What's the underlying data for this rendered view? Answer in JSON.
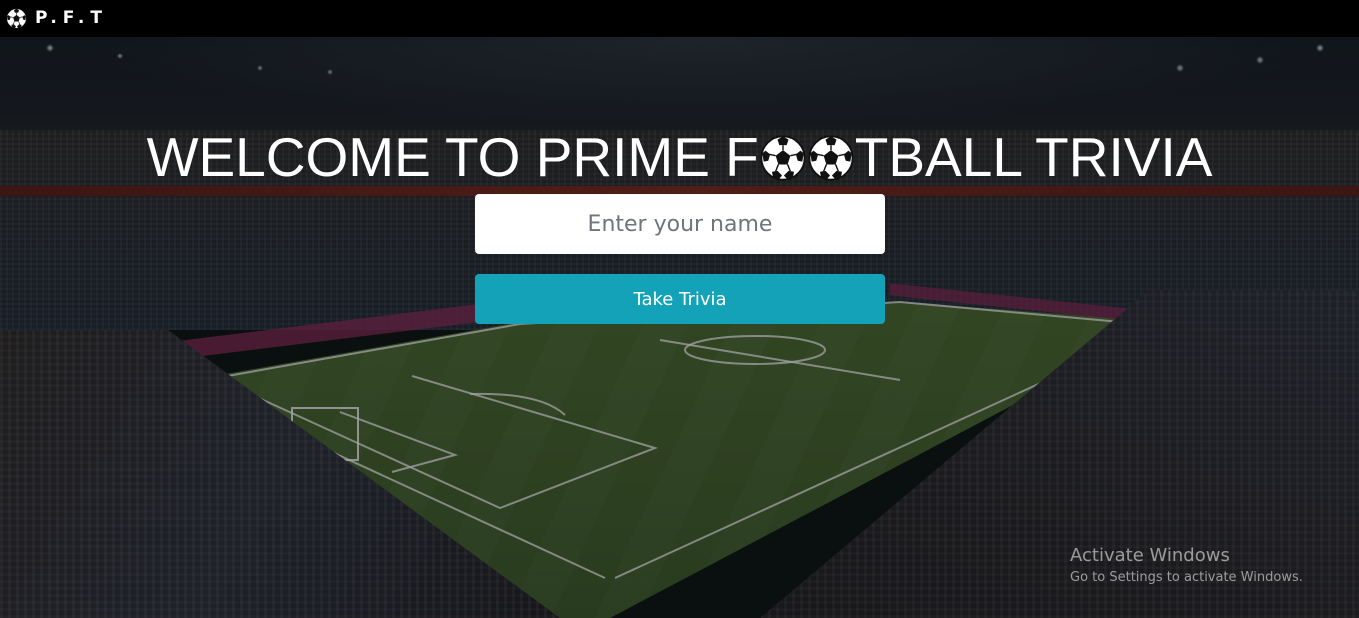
{
  "navbar": {
    "brand": "P.F.T",
    "brand_icon": "soccer-ball-icon"
  },
  "hero": {
    "title_before": "WELCOME TO PRIME F",
    "title_after": "TBALL TRIVIA",
    "title_icons": [
      "soccer-ball-icon",
      "soccer-ball-icon"
    ]
  },
  "form": {
    "name_placeholder": "Enter your name",
    "name_value": "",
    "submit_label": "Take Trivia"
  },
  "watermark": {
    "line1": "Activate Windows",
    "line2": "Go to Settings to activate Windows."
  },
  "colors": {
    "navbar": "#000000",
    "button": "#13a2b8",
    "input_bg": "#ffffff",
    "title": "#ffffff"
  }
}
